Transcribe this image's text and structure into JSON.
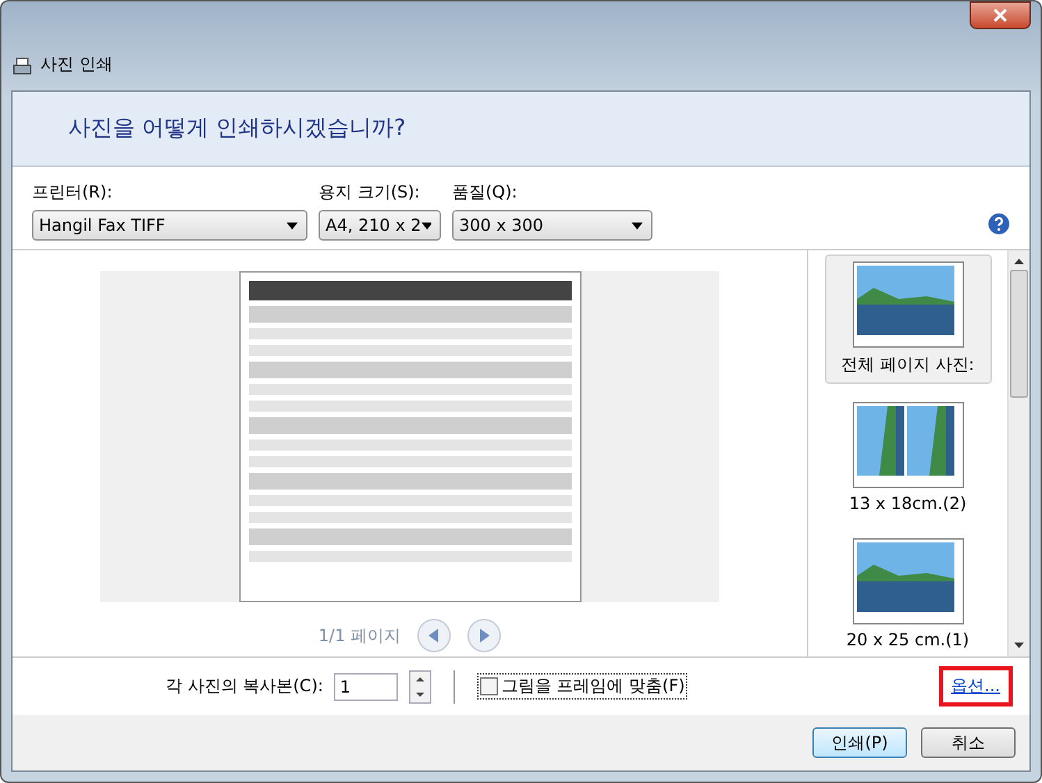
{
  "window": {
    "title": "사진 인쇄"
  },
  "heading": "사진을 어떻게 인쇄하시겠습니까?",
  "fields": [
    {
      "label": "프린터(R):",
      "value": "Hangil Fax TIFF"
    },
    {
      "label": "용지 크기(S):",
      "value": "A4, 210 x 2"
    },
    {
      "label": "품질(Q):",
      "value": "300 x 300"
    }
  ],
  "preview": {
    "page_indicator": "1/1 페이지"
  },
  "layouts": [
    {
      "label": "전체 페이지 사진:",
      "kind": "single",
      "selected": true
    },
    {
      "label": "13 x 18cm.(2)",
      "kind": "double",
      "selected": false
    },
    {
      "label": "20 x 25 cm.(1)",
      "kind": "single",
      "selected": false
    }
  ],
  "copies": {
    "label": "각 사진의 복사본(C):",
    "value": "1"
  },
  "fit_to_frame": {
    "label": "그림을 프레임에 맞춤(F)",
    "checked": false
  },
  "options_link": {
    "label": "옵션...",
    "highlighted": true
  },
  "buttons": [
    {
      "label": "인쇄(P)",
      "kind": "primary"
    },
    {
      "label": "취소",
      "kind": "normal"
    }
  ]
}
